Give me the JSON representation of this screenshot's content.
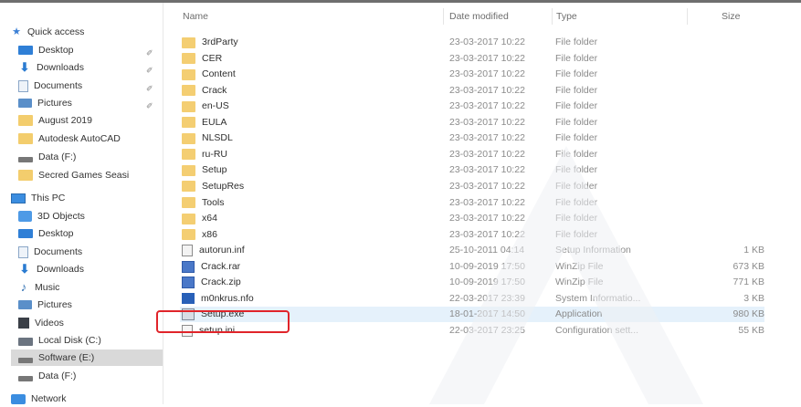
{
  "columns": {
    "name": "Name",
    "date": "Date modified",
    "type": "Type",
    "size": "Size"
  },
  "sidebar": {
    "items": [
      {
        "label": "Quick access",
        "icon": "star-icon"
      },
      {
        "label": "Desktop",
        "icon": "desktop-icon",
        "pinned": true
      },
      {
        "label": "Downloads",
        "icon": "download-icon",
        "pinned": true
      },
      {
        "label": "Documents",
        "icon": "document-icon",
        "pinned": true
      },
      {
        "label": "Pictures",
        "icon": "pictures-icon",
        "pinned": true
      },
      {
        "label": "August 2019",
        "icon": "folder-icon"
      },
      {
        "label": "Autodesk AutoCAD",
        "icon": "folder-icon"
      },
      {
        "label": "Data (F:)",
        "icon": "drive-icon"
      },
      {
        "label": "Secred Games Seasi",
        "icon": "folder-icon"
      },
      {
        "label": "This PC",
        "icon": "this-pc-icon"
      },
      {
        "label": "3D Objects",
        "icon": "3d-objects-icon"
      },
      {
        "label": "Desktop",
        "icon": "desktop-icon"
      },
      {
        "label": "Documents",
        "icon": "document-icon"
      },
      {
        "label": "Downloads",
        "icon": "download-icon"
      },
      {
        "label": "Music",
        "icon": "music-icon"
      },
      {
        "label": "Pictures",
        "icon": "pictures-icon"
      },
      {
        "label": "Videos",
        "icon": "videos-icon"
      },
      {
        "label": "Local Disk (C:)",
        "icon": "local-disk-icon"
      },
      {
        "label": "Software (E:)",
        "icon": "drive-icon",
        "selected": true
      },
      {
        "label": "Data (F:)",
        "icon": "drive-icon"
      },
      {
        "label": "Network",
        "icon": "network-icon"
      }
    ],
    "pin_glyph": "✐"
  },
  "files": [
    {
      "name": "3rdParty",
      "date": "23-03-2017 10:22",
      "type": "File folder",
      "size": "",
      "icon": "folder-icon"
    },
    {
      "name": "CER",
      "date": "23-03-2017 10:22",
      "type": "File folder",
      "size": "",
      "icon": "folder-icon"
    },
    {
      "name": "Content",
      "date": "23-03-2017 10:22",
      "type": "File folder",
      "size": "",
      "icon": "folder-icon"
    },
    {
      "name": "Crack",
      "date": "23-03-2017 10:22",
      "type": "File folder",
      "size": "",
      "icon": "folder-icon"
    },
    {
      "name": "en-US",
      "date": "23-03-2017 10:22",
      "type": "File folder",
      "size": "",
      "icon": "folder-icon"
    },
    {
      "name": "EULA",
      "date": "23-03-2017 10:22",
      "type": "File folder",
      "size": "",
      "icon": "folder-icon"
    },
    {
      "name": "NLSDL",
      "date": "23-03-2017 10:22",
      "type": "File folder",
      "size": "",
      "icon": "folder-icon"
    },
    {
      "name": "ru-RU",
      "date": "23-03-2017 10:22",
      "type": "File folder",
      "size": "",
      "icon": "folder-icon"
    },
    {
      "name": "Setup",
      "date": "23-03-2017 10:22",
      "type": "File folder",
      "size": "",
      "icon": "folder-icon"
    },
    {
      "name": "SetupRes",
      "date": "23-03-2017 10:22",
      "type": "File folder",
      "size": "",
      "icon": "folder-icon"
    },
    {
      "name": "Tools",
      "date": "23-03-2017 10:22",
      "type": "File folder",
      "size": "",
      "icon": "folder-icon"
    },
    {
      "name": "x64",
      "date": "23-03-2017 10:22",
      "type": "File folder",
      "size": "",
      "icon": "folder-icon"
    },
    {
      "name": "x86",
      "date": "23-03-2017 10:22",
      "type": "File folder",
      "size": "",
      "icon": "folder-icon"
    },
    {
      "name": "autorun.inf",
      "date": "25-10-2011 04:14",
      "type": "Setup Information",
      "size": "1 KB",
      "icon": "setup-info-icon"
    },
    {
      "name": "Crack.rar",
      "date": "10-09-2019 17:50",
      "type": "WinZip File",
      "size": "673 KB",
      "icon": "winzip-icon"
    },
    {
      "name": "Crack.zip",
      "date": "10-09-2019 17:50",
      "type": "WinZip File",
      "size": "771 KB",
      "icon": "winzip-icon"
    },
    {
      "name": "m0nkrus.nfo",
      "date": "22-03-2017 23:39",
      "type": "System Informatio...",
      "size": "3 KB",
      "icon": "system-info-icon"
    },
    {
      "name": "Setup.exe",
      "date": "18-01-2017 14:50",
      "type": "Application",
      "size": "980 KB",
      "icon": "application-icon",
      "selected": true
    },
    {
      "name": "setup.ini",
      "date": "22-03-2017 23:25",
      "type": "Configuration sett...",
      "size": "55 KB",
      "icon": "config-icon",
      "highlighted": true
    }
  ]
}
